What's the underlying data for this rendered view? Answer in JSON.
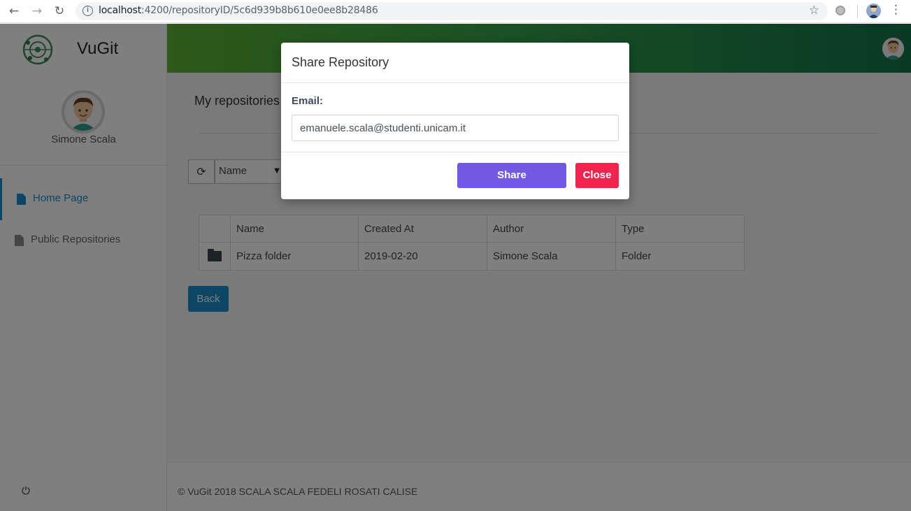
{
  "browser": {
    "url_host": "localhost",
    "url_path": ":4200/repositoryID/5c6d939b8b610e0ee8b28486",
    "icons": [
      "back-arrow-icon",
      "forward-arrow-icon",
      "reload-icon",
      "info-icon",
      "star-icon",
      "extension-icon",
      "profile-avatar-icon",
      "menu-kebab-icon"
    ]
  },
  "sidebar": {
    "brand": "VuGit",
    "user_name": "Simone Scala",
    "items": [
      {
        "label": "Home Page",
        "active": true
      },
      {
        "label": "Public Repositories",
        "active": false
      }
    ]
  },
  "main": {
    "title": "My repositories",
    "sort_value": "Name",
    "table": {
      "columns": [
        "",
        "Name",
        "Created At",
        "Author",
        "Type"
      ],
      "rows": [
        {
          "icon": "folder-icon",
          "name": "Pizza folder",
          "created_at": "2019-02-20",
          "author": "Simone Scala",
          "type": "Folder"
        }
      ]
    },
    "back_label": "Back"
  },
  "footer": {
    "text": "© VuGit 2018 SCALA SCALA FEDELI ROSATI CALISE"
  },
  "modal": {
    "title": "Share Repository",
    "email_label": "Email:",
    "email_value": "emanuele.scala@studenti.unicam.it",
    "share_label": "Share",
    "close_label": "Close"
  },
  "colors": {
    "primary": "#1b8acb",
    "share": "#7159e4",
    "close": "#f1234f",
    "header_start": "#5cb234",
    "header_end": "#15724a"
  }
}
